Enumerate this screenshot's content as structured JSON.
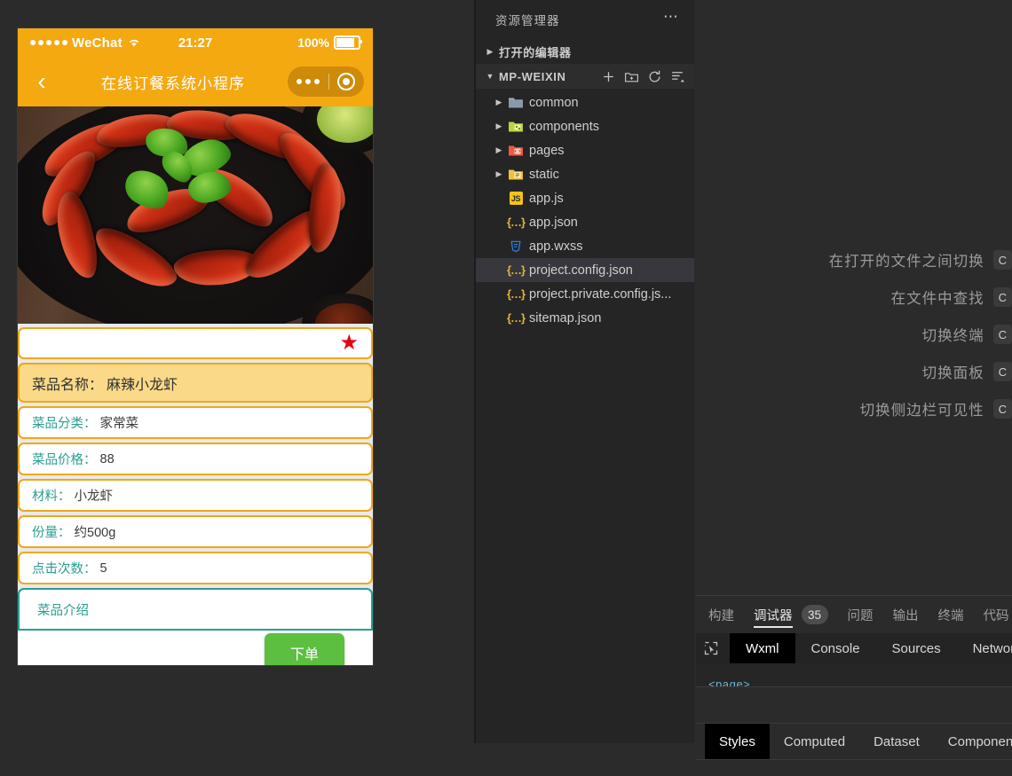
{
  "simulator": {
    "status_bar": {
      "carrier": "WeChat",
      "time": "21:27",
      "battery": "100%"
    },
    "nav": {
      "back_icon": "chevron-left-icon",
      "title": "在线订餐系统小程序",
      "capsule": {
        "more_icon": "more-dots-icon",
        "target_icon": "target-circle-icon"
      }
    },
    "photo_alt": "麻辣小龙虾",
    "favorite_icon": "star-icon",
    "fields": [
      {
        "label": "菜品名称：",
        "value": "麻辣小龙虾",
        "highlight": true
      },
      {
        "label": "菜品分类：",
        "value": "家常菜",
        "highlight": false
      },
      {
        "label": "菜品价格：",
        "value": "88",
        "highlight": false
      },
      {
        "label": "材料：",
        "value": "小龙虾",
        "highlight": false
      },
      {
        "label": "份量：",
        "value": "约500g",
        "highlight": false
      },
      {
        "label": "点击次数：",
        "value": "5",
        "highlight": false
      }
    ],
    "description_label": "菜品介绍",
    "order_button": "下单",
    "colors": {
      "brand": "#f5a911",
      "accent": "#2a9d8f",
      "order": "#5cbf40",
      "star": "#e60012",
      "highlight": "#fada89"
    }
  },
  "explorer": {
    "title": "资源管理器",
    "more_icon": "ellipsis-icon",
    "open_editors": "打开的编辑器",
    "project": "MP-WEIXIN",
    "toolbar": [
      {
        "name": "new-file-icon",
        "label": "新建文件"
      },
      {
        "name": "new-folder-icon",
        "label": "新建文件夹"
      },
      {
        "name": "refresh-icon",
        "label": "刷新"
      },
      {
        "name": "collapse-all-icon",
        "label": "折叠"
      }
    ],
    "tree": [
      {
        "name": "common",
        "type": "folder",
        "icon": "folder-blue-icon",
        "selected": false
      },
      {
        "name": "components",
        "type": "folder",
        "icon": "folder-green-icon",
        "selected": false
      },
      {
        "name": "pages",
        "type": "folder",
        "icon": "folder-red-icon",
        "selected": false
      },
      {
        "name": "static",
        "type": "folder",
        "icon": "folder-yellow-icon",
        "selected": false
      },
      {
        "name": "app.js",
        "type": "file",
        "icon": "js-file-icon",
        "selected": false
      },
      {
        "name": "app.json",
        "type": "file",
        "icon": "json-file-icon",
        "selected": false
      },
      {
        "name": "app.wxss",
        "type": "file",
        "icon": "css-file-icon",
        "selected": false
      },
      {
        "name": "project.config.json",
        "type": "file",
        "icon": "json-file-icon",
        "selected": true
      },
      {
        "name": "project.private.config.js...",
        "type": "file",
        "icon": "json-file-icon",
        "selected": false
      },
      {
        "name": "sitemap.json",
        "type": "file",
        "icon": "json-file-icon",
        "selected": false
      }
    ]
  },
  "editor": {
    "shortcuts": [
      {
        "text": "在打开的文件之间切换",
        "key": "C"
      },
      {
        "text": "在文件中查找",
        "key": "C"
      },
      {
        "text": "切换终端",
        "key": "C"
      },
      {
        "text": "切换面板",
        "key": "C"
      },
      {
        "text": "切换侧边栏可见性",
        "key": "C"
      }
    ]
  },
  "devtools": {
    "tabs": [
      {
        "label": "构建",
        "active": false,
        "badge": ""
      },
      {
        "label": "调试器",
        "active": true,
        "badge": "35"
      },
      {
        "label": "问题",
        "active": false,
        "badge": ""
      },
      {
        "label": "输出",
        "active": false,
        "badge": ""
      },
      {
        "label": "终端",
        "active": false,
        "badge": ""
      },
      {
        "label": "代码",
        "active": false,
        "badge": ""
      }
    ],
    "picker_icon": "element-picker-icon",
    "sub_tabs": [
      {
        "label": "Wxml",
        "active": true
      },
      {
        "label": "Console",
        "active": false
      },
      {
        "label": "Sources",
        "active": false
      },
      {
        "label": "Network",
        "active": false
      }
    ],
    "code_line": "<page>",
    "style_tabs": [
      {
        "label": "Styles",
        "active": true
      },
      {
        "label": "Computed",
        "active": false
      },
      {
        "label": "Dataset",
        "active": false
      },
      {
        "label": "Component Data",
        "active": false
      }
    ]
  }
}
